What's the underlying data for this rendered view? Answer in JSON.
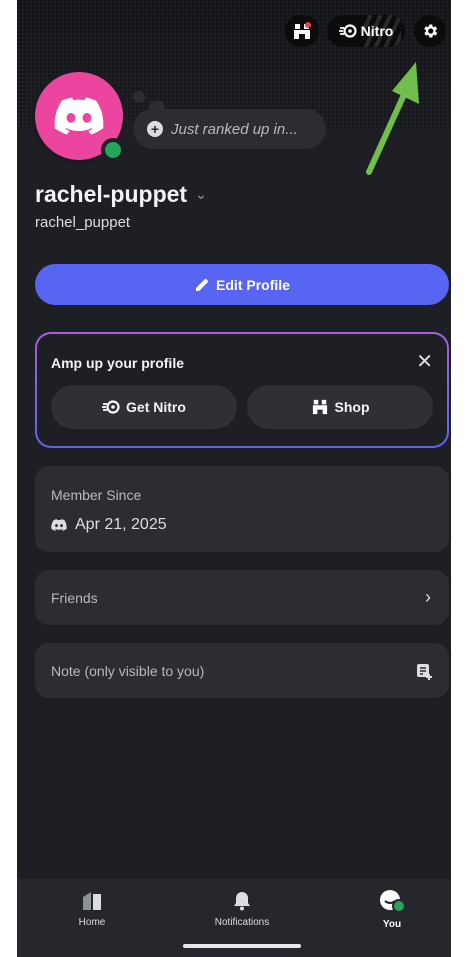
{
  "header": {
    "nitro_label": "Nitro",
    "status_placeholder": "Just ranked up in..."
  },
  "profile": {
    "display_name": "rachel-puppet",
    "username": "rachel_puppet",
    "online_status_color": "#23a55a",
    "avatar_color": "#eb459f"
  },
  "actions": {
    "edit_profile_label": "Edit Profile"
  },
  "amp_card": {
    "title": "Amp up your profile",
    "get_nitro_label": "Get Nitro",
    "shop_label": "Shop"
  },
  "member": {
    "label": "Member Since",
    "date": "Apr 21, 2025"
  },
  "friends": {
    "label": "Friends"
  },
  "note": {
    "placeholder": "Note (only visible to you)"
  },
  "tabs": [
    {
      "label": "Home"
    },
    {
      "label": "Notifications"
    },
    {
      "label": "You"
    }
  ],
  "colors": {
    "accent": "#5865f2",
    "annotation_arrow": "#6fbf4a"
  }
}
